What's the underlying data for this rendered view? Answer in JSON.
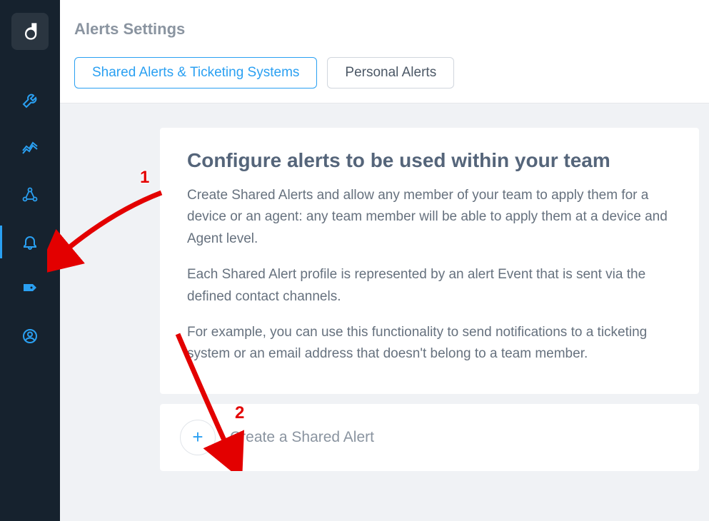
{
  "page": {
    "title": "Alerts Settings"
  },
  "tabs": {
    "shared": "Shared Alerts & Ticketing Systems",
    "personal": "Personal Alerts"
  },
  "card": {
    "title": "Configure alerts to be used within your team",
    "p1": "Create Shared Alerts and allow any member of your team to apply them for a device or an agent: any team member will be able to apply them at a device and Agent level.",
    "p2": "Each Shared Alert profile is represented by an alert Event that is sent via the defined contact channels.",
    "p3": "For example, you can use this functionality to send notifications to a ticketing system or an email address that doesn't belong to a team member."
  },
  "create": {
    "label": "Create a Shared Alert"
  },
  "annotations": {
    "n1": "1",
    "n2": "2"
  },
  "colors": {
    "accent": "#2aa0f2",
    "sidebar": "#16222e",
    "annotation": "#e30000"
  }
}
